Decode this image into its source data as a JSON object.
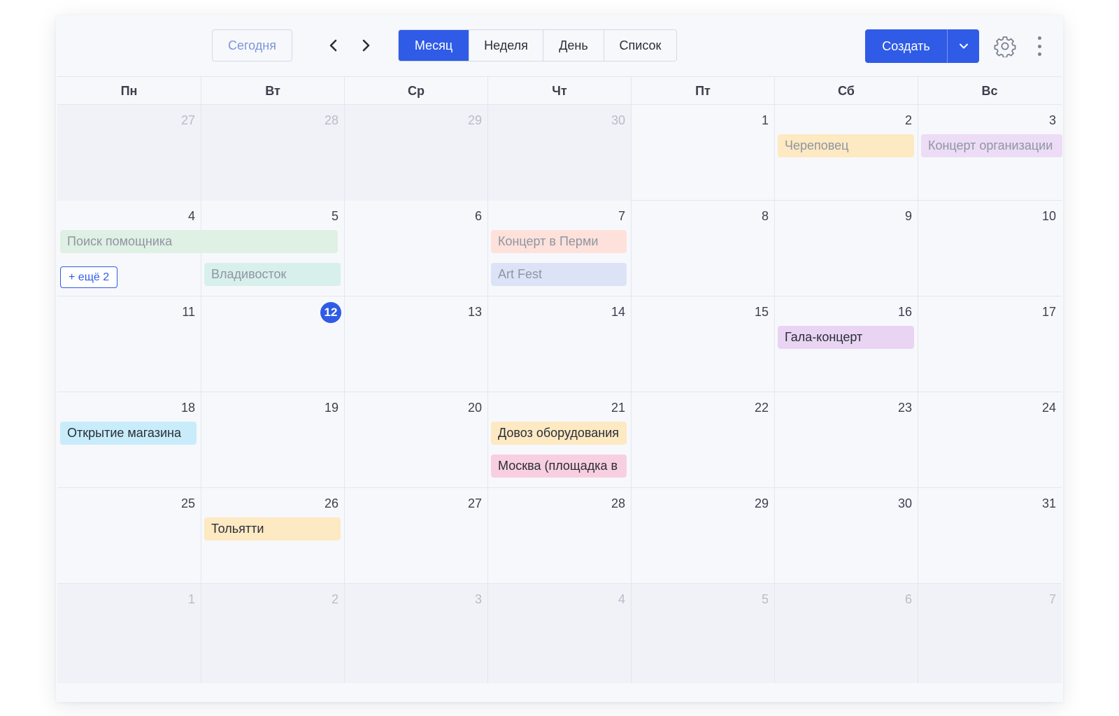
{
  "toolbar": {
    "today_label": "Сегодня",
    "views": [
      "Месяц",
      "Неделя",
      "День",
      "Список"
    ],
    "active_view": "Месяц",
    "create_label": "Создать"
  },
  "weekdays": [
    "Пн",
    "Вт",
    "Ср",
    "Чт",
    "Пт",
    "Сб",
    "Вс"
  ],
  "weeks": [
    [
      "27",
      "28",
      "29",
      "30",
      "1",
      "2",
      "3"
    ],
    [
      "4",
      "5",
      "6",
      "7",
      "8",
      "9",
      "10"
    ],
    [
      "11",
      "12",
      "13",
      "14",
      "15",
      "16",
      "17"
    ],
    [
      "18",
      "19",
      "20",
      "21",
      "22",
      "23",
      "24"
    ],
    [
      "25",
      "26",
      "27",
      "28",
      "29",
      "30",
      "31"
    ],
    [
      "1",
      "2",
      "3",
      "4",
      "5",
      "6",
      "7"
    ]
  ],
  "today": "12",
  "events": {
    "cherepovets": "Череповец",
    "concert_org": "Концерт организации",
    "assistant_search": "Поиск помощника",
    "vladivostok": "Владивосток",
    "concert_perm": "Концерт в Перми",
    "art_fest": "Art Fest",
    "gala": "Гала-концерт",
    "store_opening": "Открытие магазина",
    "equipment": "Довоз оборудования",
    "moscow": "Москва (площадка в",
    "tolyatti": "Тольятти"
  },
  "more_label": "+ ещё 2",
  "colors": {
    "accent": "#2f5be6",
    "event_yellow": "#fde9c2",
    "event_purple": "#ecdcf5",
    "event_green": "#dff0e4",
    "event_teal": "#d7f0ec",
    "event_salmon": "#fde1da",
    "event_lavender": "#dde3f7",
    "event_violet": "#e9d4f3",
    "event_sky": "#c8ecfa",
    "event_pink": "#f8cfe0"
  }
}
